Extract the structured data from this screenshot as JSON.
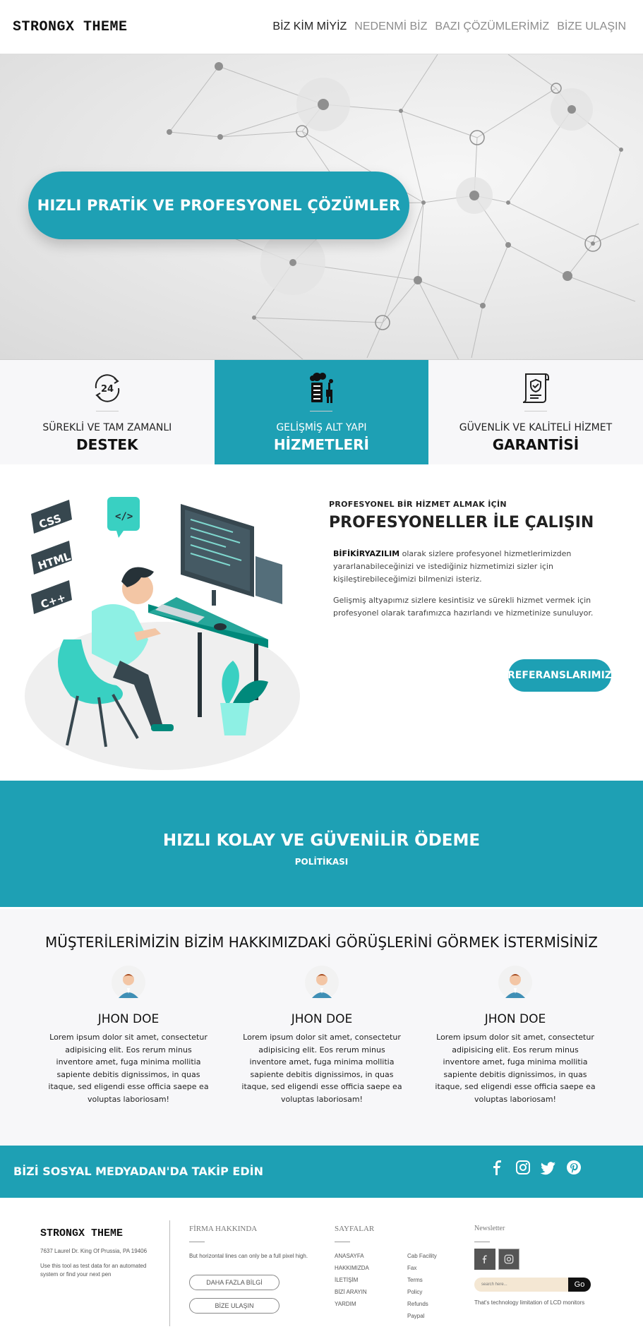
{
  "nav": {
    "brand": "STRONGX THEME",
    "items": [
      {
        "label": "BİZ KİM MİYİZ",
        "active": true
      },
      {
        "label": "NEDENMİ BİZ",
        "active": false
      },
      {
        "label": "BAZI ÇÖZÜMLERİMİZ",
        "active": false
      },
      {
        "label": "BİZE ULAŞIN",
        "active": false
      }
    ]
  },
  "hero": {
    "headline": "HIZLI PRATİK VE PROFESYONEL ÇÖZÜMLER"
  },
  "features": [
    {
      "icon": "support-24-icon",
      "sub": "SÜREKLİ VE TAM ZAMANLI",
      "title": "DESTEK"
    },
    {
      "icon": "server-infrastructure-icon",
      "sub": "GELİŞMİŞ ALT YAPI",
      "title": "HİZMETLERİ"
    },
    {
      "icon": "certificate-icon",
      "sub": "GÜVENLİK VE KALİTELİ HİZMET",
      "title": "GARANTİSİ"
    }
  ],
  "about": {
    "kicker": "PROFESYONEL BİR HİZMET ALMAK İÇİN",
    "title": "PROFESYONELLER İLE ÇALIŞIN",
    "p1_brand": "BİFİKİRYAZILIM",
    "p1_rest": " olarak sizlere profesyonel hizmetlerimizden yararlanabileceğinizi ve istediğiniz hizmetimizi sizler için kişileştirebileceğimizi bilmenizi isteriz.",
    "p2": "Gelişmiş altyapımız sizlere kesintisiz ve sürekli hizmet vermek için profesyonel olarak tarafımızca hazırlandı ve hizmetinize sunuluyor.",
    "button": "REFERANSLARIMIZ",
    "illustration_labels": [
      "CSS",
      "HTML",
      "C++",
      "</>"
    ]
  },
  "payment": {
    "title": "HIZLI KOLAY VE GÜVENİLİR ÖDEME",
    "subtitle": "POLİTİKASI"
  },
  "testimonials": {
    "heading": "MÜŞTERİLERİMİZİN BİZİM HAKKIMIZDAKİ GÖRÜŞLERİNİ GÖRMEK İSTERMİSİNİZ",
    "items": [
      {
        "name": "JHON DOE",
        "text": "Lorem ipsum dolor sit amet, consectetur adipisicing elit. Eos rerum minus inventore amet, fuga minima mollitia sapiente debitis dignissimos, in quas itaque, sed eligendi esse officia saepe ea voluptas laboriosam!"
      },
      {
        "name": "JHON DOE",
        "text": "Lorem ipsum dolor sit amet, consectetur adipisicing elit. Eos rerum minus inventore amet, fuga minima mollitia sapiente debitis dignissimos, in quas itaque, sed eligendi esse officia saepe ea voluptas laboriosam!"
      },
      {
        "name": "JHON DOE",
        "text": "Lorem ipsum dolor sit amet, consectetur adipisicing elit. Eos rerum minus inventore amet, fuga minima mollitia sapiente debitis dignissimos, in quas itaque, sed eligendi esse officia saepe ea voluptas laboriosam!"
      }
    ]
  },
  "social": {
    "title": "BİZİ SOSYAL MEDYADAN'DA TAKİP EDİN",
    "icons": [
      "facebook-icon",
      "instagram-icon",
      "twitter-icon",
      "pinterest-icon"
    ]
  },
  "footer": {
    "brand": "STRONGX THEME",
    "address": "7637 Laurel Dr. King Of Prussia, PA 19406",
    "desc": "Use this tool as test data for an automated system or find your next pen",
    "about_title": "FİRMA HAKKINDA",
    "about_text": "But horizontal lines can only be a full pixel high.",
    "btn_more": "DAHA FAZLA BİLGİ",
    "btn_contact": "BİZE ULAŞIN",
    "pages_title": "SAYFALAR",
    "pages_col1": [
      "ANASAYFA",
      "HAKKIMIZDA",
      "İLETİŞİM",
      "BİZİ ARAYIN",
      "YARDIM"
    ],
    "pages_col2": [
      "Cab Facility",
      "Fax",
      "Terms",
      "Policy",
      "Refunds",
      "Paypal"
    ],
    "newsletter_title": "Newsletter",
    "search_placeholder": "search here...",
    "go": "Go",
    "newsletter_note": "That's technology limitation of LCD monitors"
  },
  "colors": {
    "accent": "#1ea0b4"
  }
}
